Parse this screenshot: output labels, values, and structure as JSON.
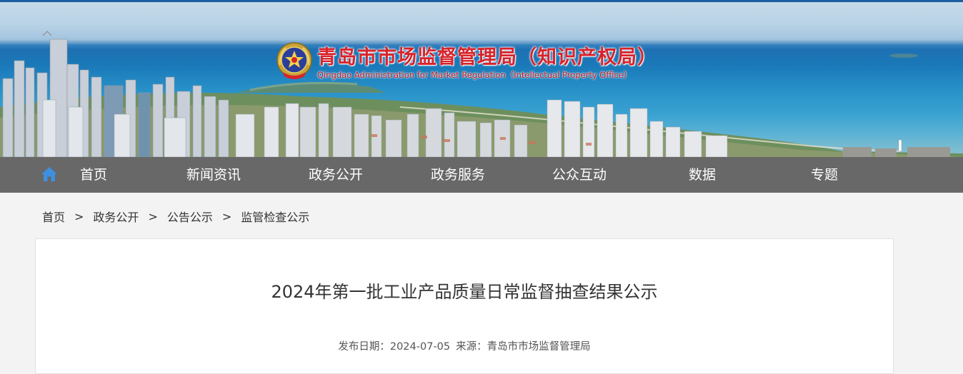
{
  "header": {
    "title": "青岛市市场监督管理局（知识产权局）",
    "subtitle": "Qingdao Administration for Market Regulation（Intellectual Property Office）"
  },
  "nav": {
    "home_icon": "home-icon",
    "items": [
      {
        "label": "首页"
      },
      {
        "label": "新闻资讯"
      },
      {
        "label": "政务公开"
      },
      {
        "label": "政务服务"
      },
      {
        "label": "公众互动"
      },
      {
        "label": "数据"
      },
      {
        "label": "专题"
      }
    ]
  },
  "breadcrumb": {
    "items": [
      {
        "label": "首页"
      },
      {
        "label": "政务公开"
      },
      {
        "label": "公告公示"
      },
      {
        "label": "监管检查公示"
      }
    ],
    "separator": ">"
  },
  "article": {
    "title": "2024年第一批工业产品质量日常监督抽查结果公示",
    "date_label": "发布日期：",
    "date": "2024-07-05",
    "source_label": "来源：",
    "source": "青岛市市场监督管理局"
  },
  "colors": {
    "title_red": "#d8232a",
    "nav_bg": "#5c5c5c",
    "home_icon_blue": "#3e8fe0",
    "page_bg": "#f3f3f3"
  }
}
